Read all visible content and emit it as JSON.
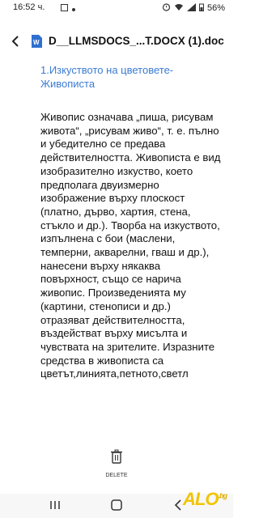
{
  "status_bar": {
    "time": "16:52 ч.",
    "battery": "56%"
  },
  "app_bar": {
    "title": "D__LLMSDOCS_...T.DOCX (1).doc"
  },
  "document": {
    "heading": "1.Изкуството на цветовете-Живописта",
    "body": "Живопис означава „пиша, рисувам живота“, „рисувам живо“, т. е. пълно и убедително се предава действителността. Живописта е вид изобразително изкуство, което предполага двуизмерно изображение върху плоскост (платно, дърво, хартия, стена, стъкло и др.). Творба на изкуството, изпълнена с бои (маслени, темперни, акварелни, гваш и др.), нанесени върху някаква повърхност, също се нарича живопис. Произведенията му (картини, стенописи и др.) отразяват действителността, въздействат върху мисълта и чувствата на зрителите. Изразните средства в живописта са цветът,линията,петното,светл"
  },
  "footer": {
    "delete_label": "DELETE"
  },
  "watermark": {
    "text": "ALO",
    "suffix": ".bg"
  },
  "colors": {
    "heading": "#3b7bd4",
    "doc_icon": "#2f6fd0",
    "watermark": "#f2c400"
  }
}
